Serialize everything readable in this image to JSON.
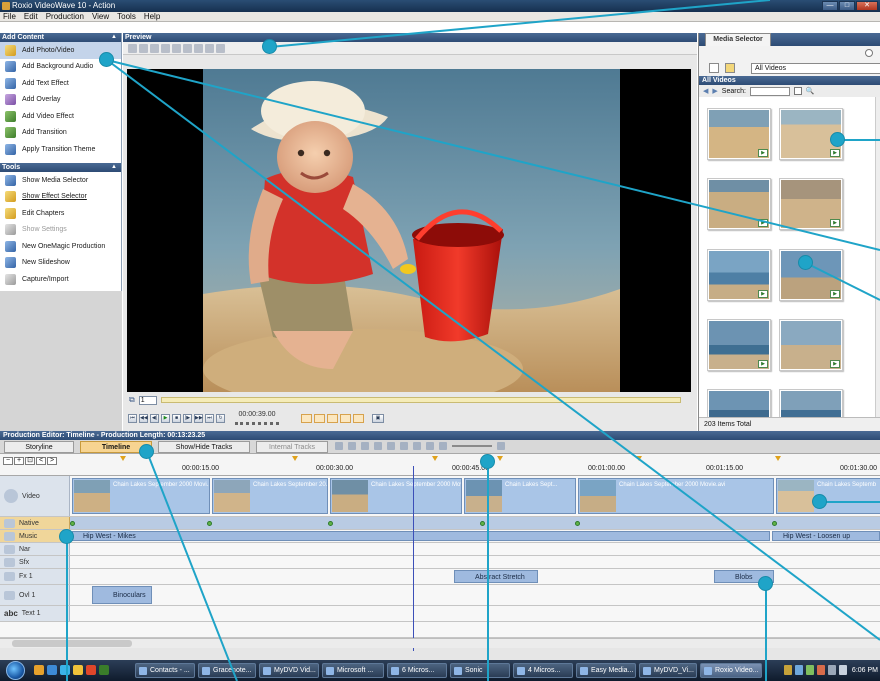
{
  "window": {
    "title": "Roxio VideoWave 10 - Action",
    "controls": [
      "—",
      "□",
      "✕"
    ]
  },
  "menu": [
    "File",
    "Edit",
    "Production",
    "View",
    "Tools",
    "Help"
  ],
  "add_content": {
    "title": "Add Content",
    "items": [
      {
        "label": "Add Photo/Video",
        "icon": "photo-video-icon"
      },
      {
        "label": "Add Background Audio",
        "icon": "audio-icon"
      },
      {
        "label": "Add Text Effect",
        "icon": "text-effect-icon"
      },
      {
        "label": "Add Overlay",
        "icon": "overlay-icon"
      },
      {
        "label": "Add Video Effect",
        "icon": "video-effect-icon"
      },
      {
        "label": "Add Transition",
        "icon": "transition-icon"
      },
      {
        "label": "Apply Transition Theme",
        "icon": "transition-theme-icon"
      }
    ]
  },
  "tools": {
    "title": "Tools",
    "items": [
      {
        "label": "Show Media Selector",
        "icon": "media-selector-icon"
      },
      {
        "label": "Show Effect Selector",
        "icon": "effect-selector-icon"
      },
      {
        "label": "Edit Chapters",
        "icon": "chapters-icon"
      },
      {
        "label": "Show Settings",
        "icon": "settings-icon"
      },
      {
        "label": "New OneMagic Production",
        "icon": "onemagic-icon"
      },
      {
        "label": "New Slideshow",
        "icon": "slideshow-icon"
      },
      {
        "label": "Capture/Import",
        "icon": "capture-icon"
      }
    ]
  },
  "preview": {
    "title": "Preview",
    "frame": "1",
    "timecode": "00:00:39.00"
  },
  "media_selector": {
    "tab": "Media Selector",
    "filter": "All Videos",
    "header": "All Videos",
    "search_label": "Search:",
    "count": "203 Items Total"
  },
  "editor": {
    "title": "Production Editor: Timeline - Production Length: 00:13:23.25",
    "tabs": [
      "Storyline",
      "Timeline",
      "Show/Hide Tracks",
      "Internal Tracks"
    ],
    "ruler_ticks": [
      "00:00:15.00",
      "00:00:30.00",
      "00:00:45.00",
      "00:01:00.00",
      "00:01:15.00",
      "00:01:30.00"
    ],
    "tracks": [
      "Video",
      "Native",
      "Music",
      "Nar",
      "Sfx",
      "Fx 1",
      "Ovl 1",
      "Text 1"
    ],
    "video_clips": [
      "Chain Lakes September 2000 Movi...",
      "Chain Lakes September 20...",
      "Chain Lakes September 2000 Movie.avi",
      "Chain Lakes Sept...",
      "Chain Lakes September 2000 Movie.avi",
      "Chain Lakes Septemb"
    ],
    "music_clips": [
      "Hip West - Mikes",
      "Hip West - Loosen up"
    ],
    "fx_clips": [
      "Abstract Stretch",
      "Blobs"
    ],
    "overlay_clips": [
      "Binoculars"
    ],
    "text_track_label": "abc"
  },
  "taskbar": {
    "items": [
      "Contacts - ...",
      "Gracenote...",
      "MyDVD Vid...",
      "Microsoft ...",
      "6 Micros...",
      "Sonic",
      "4 Micros...",
      "Easy Media...",
      "MyDVD_Vi...",
      "Roxio Video..."
    ],
    "active": "Roxio Video...",
    "clock": "6:06 PM"
  }
}
